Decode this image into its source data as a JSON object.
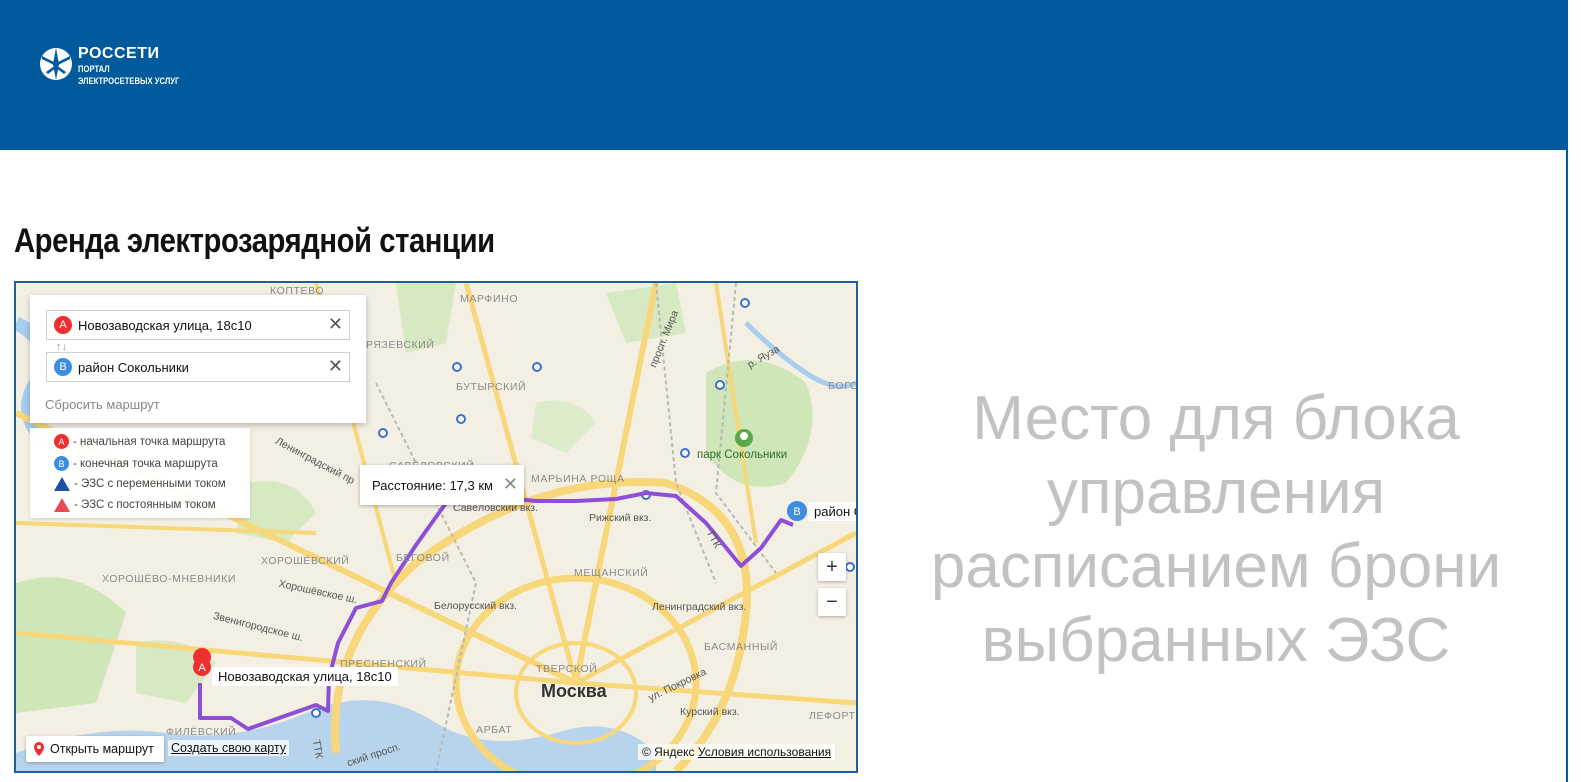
{
  "header": {
    "brand_name": "РОССЕТИ",
    "brand_sub_1": "ПОРТАЛ",
    "brand_sub_2": "ЭЛЕКТРОСЕТЕВЫХ УСЛУГ",
    "background_color": "#005a9b"
  },
  "page": {
    "title": "Аренда электрозарядной станции",
    "placeholder_text": "Место для блока управления расписанием брони выбранных ЭЗС"
  },
  "map": {
    "route": {
      "point_a": {
        "pin_label": "A",
        "value": "Новозаводская улица, 18с10",
        "color": "#ef2f2f"
      },
      "point_b": {
        "pin_label": "B",
        "value": "район Сокольники",
        "color": "#3d8de0"
      },
      "swap_icon": "↑↓",
      "reset_label": "Сбросить маршрут",
      "route_color": "#8e4fd6"
    },
    "legend": {
      "items": [
        {
          "mark": "A",
          "label": "- начальная точка маршрута"
        },
        {
          "mark": "B",
          "label": "- конечная точка маршрута"
        },
        {
          "mark": "triangle-ac-icon",
          "label": "- ЭЗС с переменными током"
        },
        {
          "mark": "triangle-dc-icon",
          "label": "- ЭЗС с постоянным током"
        }
      ]
    },
    "distance_label": "Расстояние: 17,3 км",
    "marker_a_label": "Новозаводская улица, 18с10",
    "marker_b_label": "район С",
    "city_label": "Москва",
    "park_label": "парк Сокольники",
    "district_labels": [
      "КОПТЕВО",
      "МАРФИНО",
      "РЯЗЕВСКИЙ",
      "БУТЫРСКИЙ",
      "САВЁЛОВСКИЙ",
      "МАРЬИНА РОЩА",
      "ХОРОШЁВСКИЙ",
      "БЕГОВОЙ",
      "ХОРОШЁВО-МНЕВНИКИ",
      "МЕЩАНСКИЙ",
      "ПРЕСНЕНСКИЙ",
      "ТВЕРСКОЙ",
      "БАСМАННЫЙ",
      "АРБАТ",
      "ФИЛЁВСКИЙ",
      "ЛЕФОРТ",
      "БОГО"
    ],
    "station_labels": [
      "Савёловский вкз.",
      "Рижский вкз.",
      "Белорусский вкз.",
      "Ленинградский вкз.",
      "Курский вкз."
    ],
    "road_labels": [
      "просп. Мира",
      "р. Яуза",
      "Ленинградский пр",
      "Хорошёвское ш.",
      "Звенигородское ш.",
      "ул. Покровка",
      "ТТК",
      "ТТК",
      "ский просп."
    ],
    "zoom_in_label": "+",
    "zoom_out_label": "−",
    "open_route_label": "Открыть маршрут",
    "create_map_label": "Создать свою карту",
    "copyright_label": "© Яндекс",
    "terms_label": "Условия использования"
  }
}
